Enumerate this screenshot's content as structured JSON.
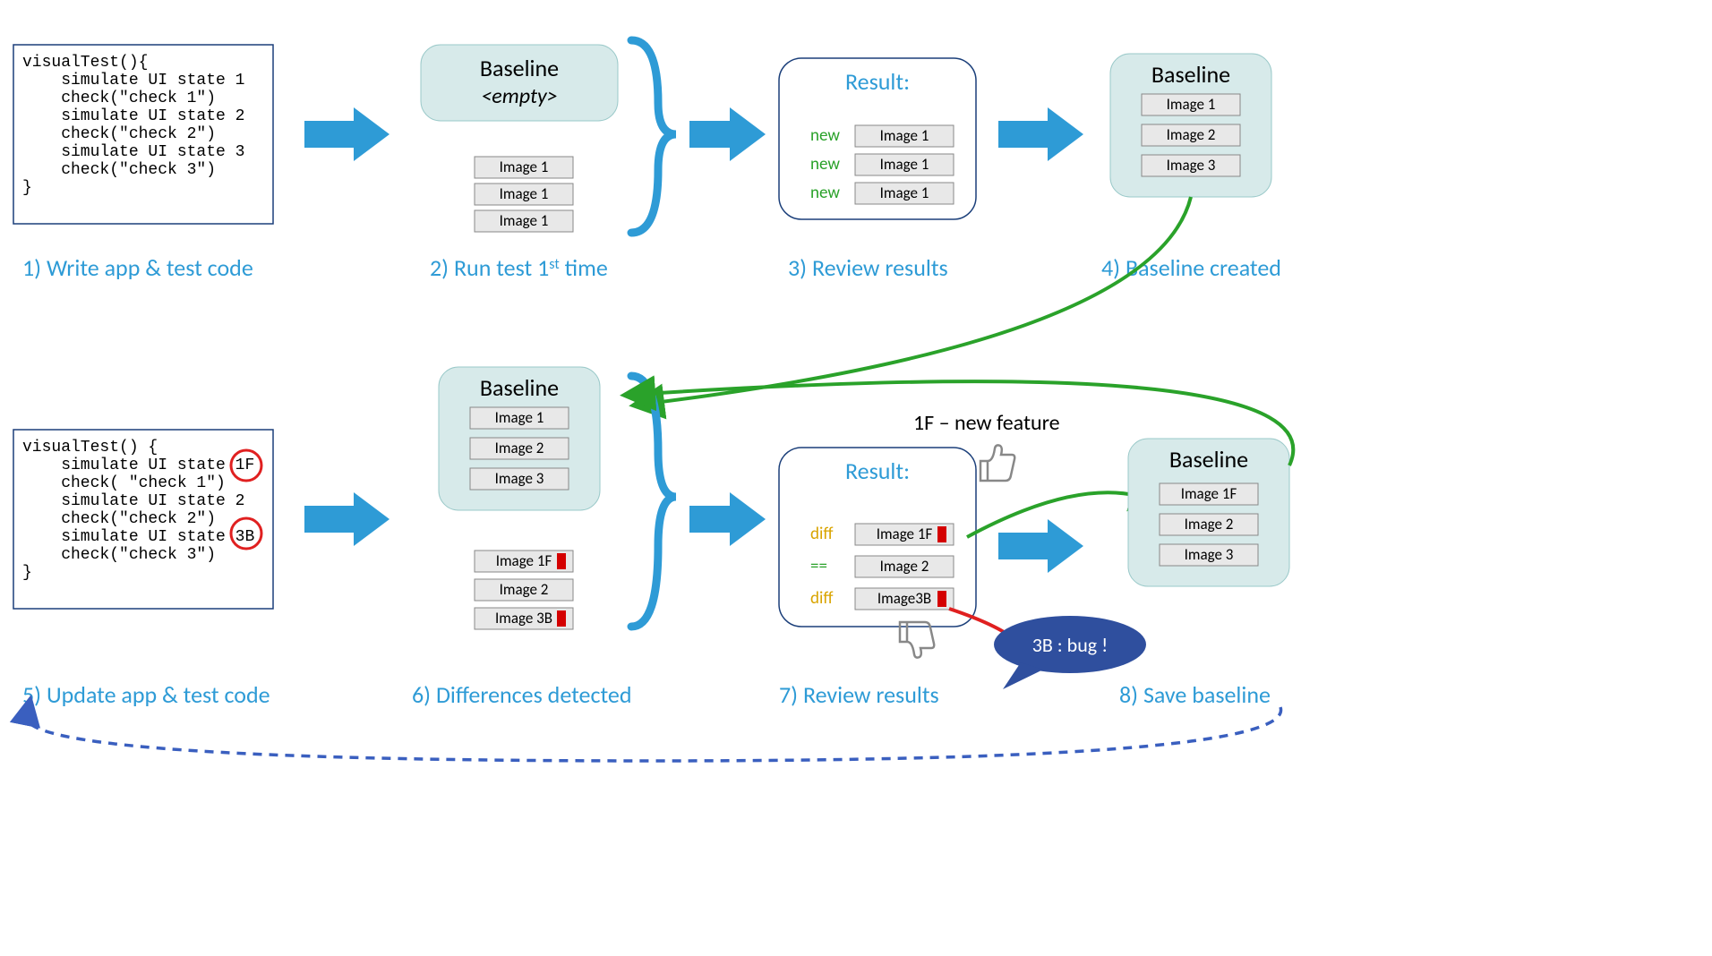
{
  "code1": {
    "lines": [
      "visualTest(){",
      "    simulate UI state 1",
      "    check(\"check 1\")",
      "    simulate UI state 2",
      "    check(\"check 2\")",
      "    simulate UI state 3",
      "    check(\"check 3\")",
      "}"
    ]
  },
  "code2": {
    "lines": [
      "visualTest() {",
      "    simulate UI state 1F",
      "    check( \"check 1\")",
      "    simulate UI state 2",
      "    check(\"check 2\")",
      "    simulate UI state 3B",
      "    check(\"check 3\")",
      "}"
    ],
    "circleA": "1F",
    "circleB": "3B"
  },
  "baseline1": {
    "title": "Baseline",
    "sub": "<empty>"
  },
  "images1": [
    "Image 1",
    "Image 1",
    "Image 1"
  ],
  "result1": {
    "title": "Result:",
    "rows": [
      {
        "tag": "new",
        "label": "Image 1"
      },
      {
        "tag": "new",
        "label": "Image 1"
      },
      {
        "tag": "new",
        "label": "Image 1"
      }
    ]
  },
  "baseline2": {
    "title": "Baseline",
    "items": [
      "Image 1",
      "Image 2",
      "Image 3"
    ]
  },
  "baseline3": {
    "title": "Baseline",
    "items": [
      "Image 1",
      "Image 2",
      "Image 3"
    ]
  },
  "images2": [
    {
      "label": "Image 1F",
      "diff": true
    },
    {
      "label": "Image 2",
      "diff": false
    },
    {
      "label": "Image 3B",
      "diff": true
    }
  ],
  "result2": {
    "title": "Result:",
    "rows": [
      {
        "tag": "diff",
        "label": "Image 1F",
        "diff": true,
        "tagColor": "#d9a400"
      },
      {
        "tag": "==",
        "label": "Image 2",
        "diff": false,
        "tagColor": "#2aa22a"
      },
      {
        "tag": "diff",
        "label": "Image3B",
        "diff": true,
        "tagColor": "#d9a400"
      }
    ]
  },
  "feature": "1F – new feature",
  "bug": "3B : bug !",
  "baseline4": {
    "title": "Baseline",
    "items": [
      "Image 1F",
      "Image 2",
      "Image 3"
    ]
  },
  "captions": {
    "c1": "1) Write app & test code",
    "c2": "2) Run test 1",
    "c2sup": "st",
    "c2b": " time",
    "c3": "3) Review results",
    "c4": "4) Baseline created",
    "c5": "5) Update app & test code",
    "c6": "6) Differences detected",
    "c7": "7) Review results",
    "c8": "8) Save baseline"
  }
}
